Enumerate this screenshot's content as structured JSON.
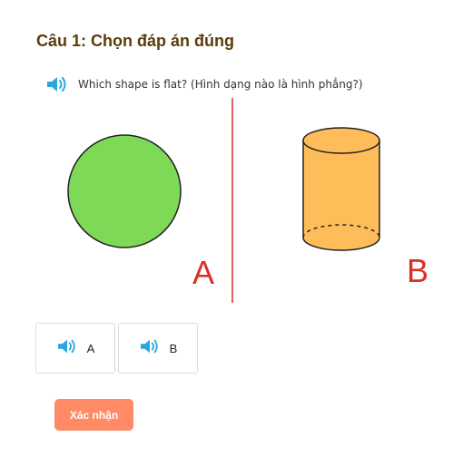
{
  "question": {
    "title": "Câu 1: Chọn đáp án đúng",
    "prompt": "Which shape is flat? (Hình dạng nào là hình phẳng?)"
  },
  "figure": {
    "label_a": "A",
    "label_b": "B",
    "circle_color": "#7ed957",
    "cylinder_color": "#ffbd59",
    "divider_color": "#d93025",
    "label_color": "#d93025"
  },
  "options": [
    {
      "label": "A"
    },
    {
      "label": "B"
    }
  ],
  "confirm_label": "Xác nhận",
  "colors": {
    "speaker": "#29a8e0",
    "title": "#5a3d09",
    "confirm": "#ff8a65"
  }
}
